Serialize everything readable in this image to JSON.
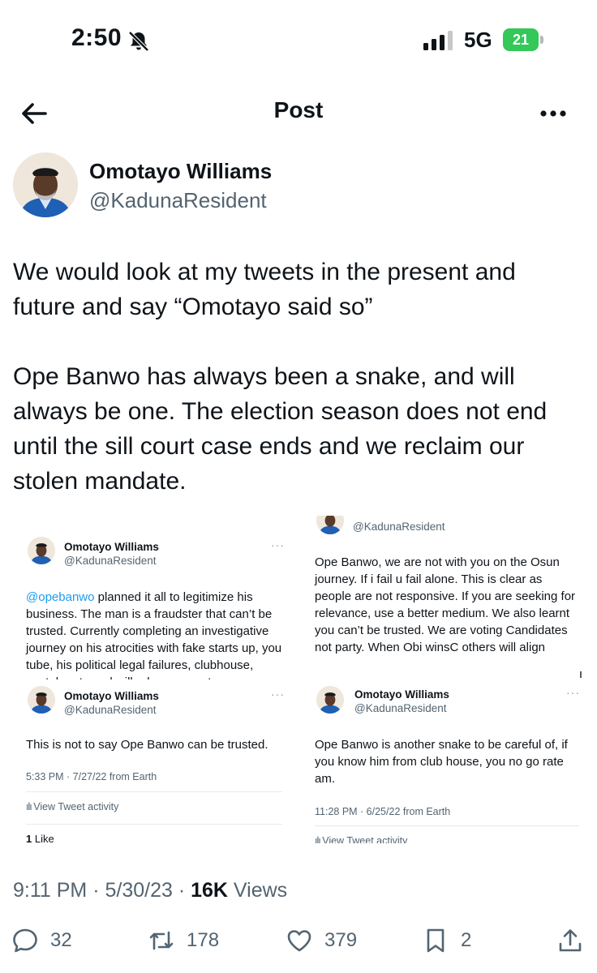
{
  "status_bar": {
    "time": "2:50",
    "network": "5G",
    "battery": "21"
  },
  "nav": {
    "title": "Post"
  },
  "author": {
    "name": "Omotayo Williams",
    "handle": "@KadunaResident"
  },
  "post": {
    "text": "We would look at my tweets in the present and future and say “Omotayo said so”\n\nOpe Banwo has always been a snake, and will always be one. The election season does not end until the sill court case ends and we reclaim our stolen mandate."
  },
  "embeds": {
    "top_left": {
      "name": "Omotayo Williams",
      "handle": "@KadunaResident",
      "mention": "@opebanwo",
      "text": " planned it all to legitimize his business. The man is a fraudster that can’t be trusted. Currently completing an investigative journey on his atrocities with fake starts up, you tube, his political legal failures, clubhouse, youtube etc and will release report soon."
    },
    "top_right": {
      "handle": "@KadunaResident",
      "text": "Ope Banwo, we are not with you on the Osun journey. If i fail u fail alone. This is clear as people are not responsive. If you are seeking for relevance, use a better medium. We also learnt you can’t be trusted. We are voting Candidates not party. When Obi winsC others will align"
    },
    "bottom_left": {
      "name": "Omotayo Williams",
      "handle": "@KadunaResident",
      "text": "This is not to say Ope Banwo can be trusted.",
      "meta": "5:33 PM · 7/27/22 from Earth",
      "activity": "View Tweet activity",
      "likes_count": "1",
      "likes_label": "Like"
    },
    "bottom_right": {
      "name": "Omotayo Williams",
      "handle": "@KadunaResident",
      "text": "Ope Banwo is another snake to be careful of, if you know him from club house, you no go rate am.",
      "meta": "11:28 PM · 6/25/22 from Earth",
      "activity": "View Tweet activity"
    }
  },
  "meta": {
    "datetime": "9:11 PM · 5/30/23 · ",
    "views_count": "16K",
    "views_label": " Views"
  },
  "actions": {
    "replies": "32",
    "reposts": "178",
    "likes": "379",
    "bookmarks": "2"
  },
  "colors": {
    "link": "#1d9bf0",
    "secondary_text": "#536471",
    "battery": "#34c759"
  }
}
